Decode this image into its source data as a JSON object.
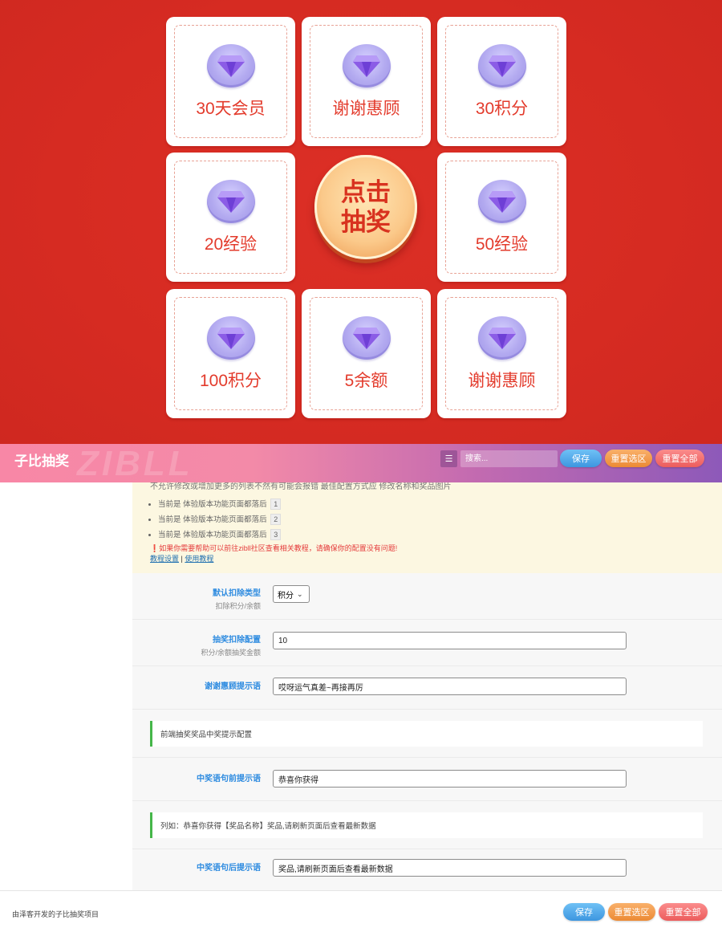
{
  "board": {
    "prizes": [
      {
        "label": "30天会员"
      },
      {
        "label": "谢谢惠顾"
      },
      {
        "label": "30积分"
      },
      {
        "label": "20经验"
      },
      {
        "label": "50经验"
      },
      {
        "label": "100积分"
      },
      {
        "label": "5余额"
      },
      {
        "label": "谢谢惠顾"
      }
    ],
    "draw_label": "点击抽奖"
  },
  "header": {
    "title": "子比抽奖",
    "watermark": "ZIBLL",
    "search_placeholder": "搜索...",
    "save": "保存",
    "reset_section": "重置选区",
    "reset_all": "重置全部"
  },
  "notice": {
    "cut_text": "不允许修改或增加更多的列表不然有可能会报错 最佳配置方式应 修改名称和奖品图片",
    "items": [
      {
        "text": "当前是 体验版本功能页面都落后",
        "num": "1"
      },
      {
        "text": "当前是 体验版本功能页面都落后",
        "num": "2"
      },
      {
        "text": "当前是 体验版本功能页面都落后",
        "num": "3"
      }
    ],
    "warning": "如果你需要帮助可以前往zibll社区查看相关教程，请确保你的配置没有问题!",
    "link1": "教程设置",
    "separator": "|",
    "link2": "使用教程"
  },
  "form": {
    "deduct_type": {
      "title": "默认扣除类型",
      "sub": "扣除积分/余额",
      "value": "积分"
    },
    "deduct_amount": {
      "title": "抽奖扣除配置",
      "sub": "积分/余额抽奖金额",
      "value": "10"
    },
    "thanks_tip": {
      "title": "谢谢惠顾提示语",
      "value": "哎呀运气真差~再接再厉"
    },
    "section_tip": "前端抽奖奖品中奖提示配置",
    "prefix_tip": {
      "title": "中奖语句前提示语",
      "value": "恭喜你获得"
    },
    "example_tip": "列如：恭喜你获得【奖品名称】奖品,请刷新页面后查看最新数据",
    "suffix_tip": {
      "title": "中奖语句后提示语",
      "value": "奖品,请刷新页面后查看最新数据"
    }
  },
  "footer": {
    "text": "由泽客开发的子比抽奖项目",
    "save": "保存",
    "reset_section": "重置选区",
    "reset_all": "重置全部"
  },
  "colors": {
    "board_red": "#d62b22",
    "prize_text": "#e33b2c",
    "label_blue": "#2f8ce0",
    "green_bar": "#45b649"
  }
}
